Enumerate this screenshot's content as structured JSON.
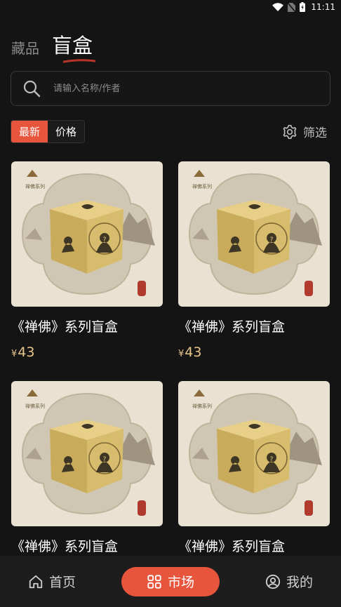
{
  "status": {
    "time": "11:11"
  },
  "header": {
    "tab_collection": "藏品",
    "tab_blind_box": "盲盒"
  },
  "search": {
    "placeholder": "请输入名称/作者"
  },
  "sort": {
    "latest": "最新",
    "price": "价格"
  },
  "filter": {
    "label": "筛选"
  },
  "products": [
    {
      "title": "《禅佛》系列盲盒",
      "currency": "¥",
      "price": "43",
      "image_caption": "禅佛系列"
    },
    {
      "title": "《禅佛》系列盲盒",
      "currency": "¥",
      "price": "43",
      "image_caption": "禅佛系列"
    },
    {
      "title": "《禅佛》系列盲盒",
      "image_caption": "禅佛系列"
    },
    {
      "title": "《禅佛》系列盲盒",
      "image_caption": "禅佛系列"
    }
  ],
  "nav": {
    "home": "首页",
    "market": "市场",
    "mine": "我的"
  },
  "colors": {
    "accent": "#e8553d",
    "price": "#e8c58a",
    "background": "#141414"
  }
}
